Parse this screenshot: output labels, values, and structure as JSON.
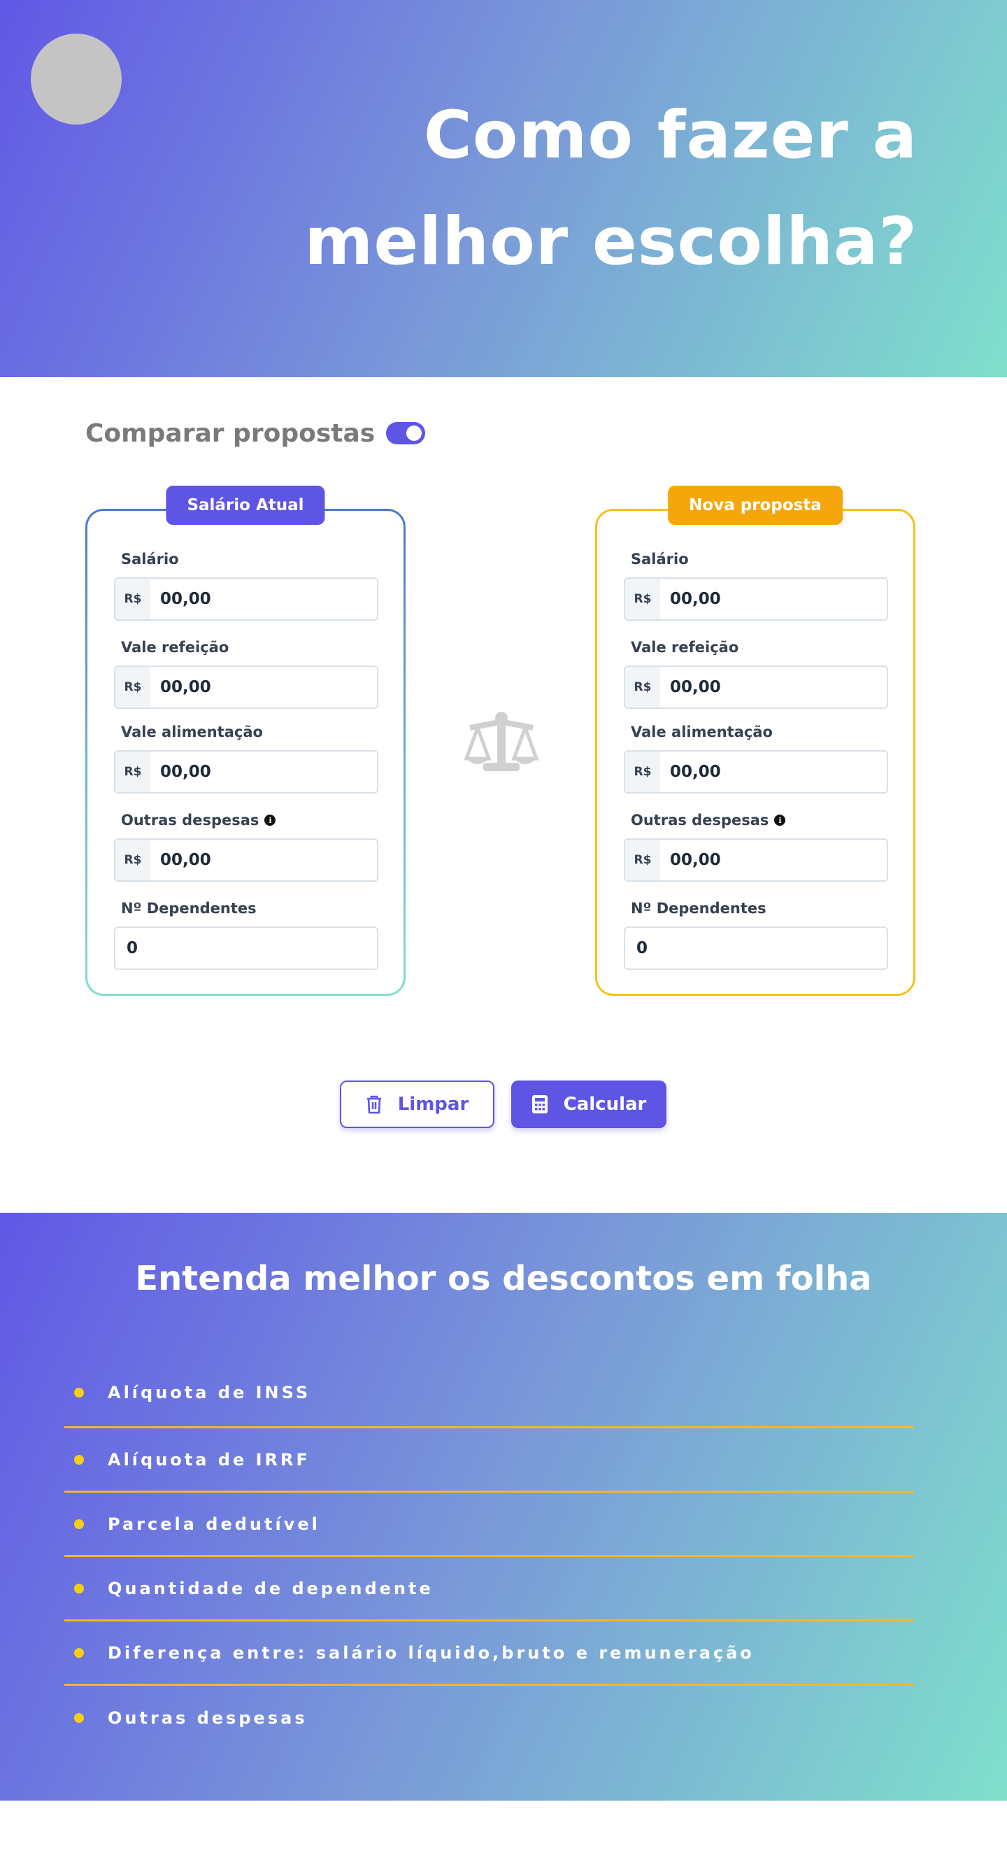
{
  "hero": {
    "title_line1": "Como fazer a",
    "title_line2": "melhor escolha?"
  },
  "compare": {
    "label": "Comparar propostas",
    "toggle_on": true
  },
  "currency_prefix": "R$",
  "cards": [
    {
      "tag": "Salário Atual",
      "accent": "#5e55e4",
      "fields": [
        {
          "label": "Salário",
          "value": "00,00"
        },
        {
          "label": "Vale refeição",
          "value": "00,00"
        },
        {
          "label": "Vale alimentação",
          "value": "00,00"
        },
        {
          "label": "Outras despesas",
          "value": "00,00"
        },
        {
          "label": "Nº Dependentes",
          "value": "0"
        }
      ]
    },
    {
      "tag": "Nova proposta",
      "accent": "#f5a70a",
      "fields": [
        {
          "label": "Salário",
          "value": "00,00"
        },
        {
          "label": "Vale refeição",
          "value": "00,00"
        },
        {
          "label": "Vale alimentação",
          "value": "00,00"
        },
        {
          "label": "Outras despesas",
          "value": "00,00"
        },
        {
          "label": "Nº Dependentes",
          "value": "0"
        }
      ]
    }
  ],
  "buttons": {
    "clear_label": "Limpar",
    "calculate_label": "Calcular"
  },
  "info": {
    "title": "Entenda melhor os descontos em folha",
    "items": [
      "Alíquota de INSS",
      "Alíquota de IRRF",
      "Parcela dedutível",
      "Quantidade de dependente",
      "Diferença entre: salário líquido,bruto e remuneração",
      "Outras despesas"
    ]
  },
  "colors": {
    "primary": "#5e55e4",
    "secondary": "#f5a70a",
    "gradient_start": "#6158e6",
    "gradient_end": "#7fe0cc",
    "bullet": "#f5cf17"
  }
}
